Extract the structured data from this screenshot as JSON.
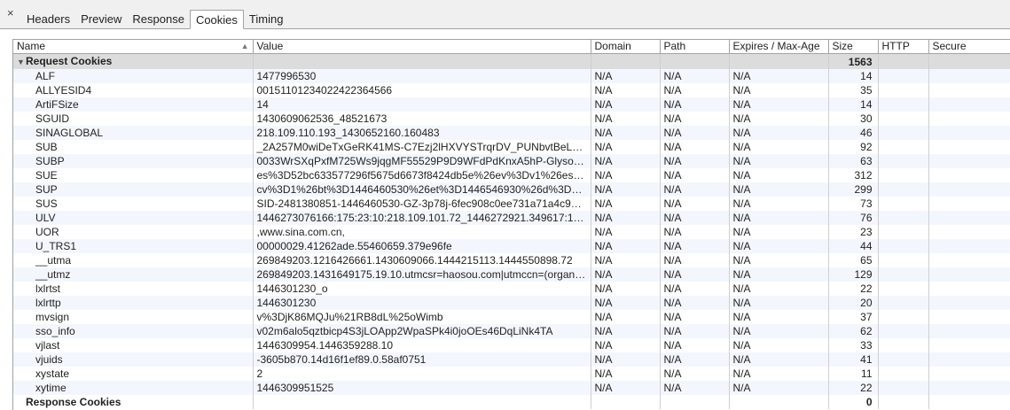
{
  "tabs": [
    {
      "label": "Headers",
      "active": false
    },
    {
      "label": "Preview",
      "active": false
    },
    {
      "label": "Response",
      "active": false
    },
    {
      "label": "Cookies",
      "active": true
    },
    {
      "label": "Timing",
      "active": false
    }
  ],
  "close_label": "×",
  "columns": {
    "name": "Name",
    "value": "Value",
    "domain": "Domain",
    "path": "Path",
    "expires": "Expires / Max-Age",
    "size": "Size",
    "http": "HTTP",
    "secure": "Secure"
  },
  "request_group": {
    "triangle": "▼",
    "label": "Request Cookies",
    "size": "1563"
  },
  "response_group": {
    "label": "Response Cookies",
    "size": "0"
  },
  "cookies": [
    {
      "name": "ALF",
      "value": "1477996530",
      "domain": "N/A",
      "path": "N/A",
      "expires": "N/A",
      "size": "14"
    },
    {
      "name": "ALLYESID4",
      "value": "0015110123402242236456​6",
      "domain": "N/A",
      "path": "N/A",
      "expires": "N/A",
      "size": "35"
    },
    {
      "name": "ArtiFSize",
      "value": "14",
      "domain": "N/A",
      "path": "N/A",
      "expires": "N/A",
      "size": "14"
    },
    {
      "name": "SGUID",
      "value": "1430609062536_48521673",
      "domain": "N/A",
      "path": "N/A",
      "expires": "N/A",
      "size": "30"
    },
    {
      "name": "SINAGLOBAL",
      "value": "218.109.110.193_1430652160.160483",
      "domain": "N/A",
      "path": "N/A",
      "expires": "N/A",
      "size": "46"
    },
    {
      "name": "SUB",
      "value": "_2A257M0wiDeTxGeRK41MS-C7Ezj2lHXVYSTrqrDV_PUNbvtBeLRfEk...",
      "domain": "N/A",
      "path": "N/A",
      "expires": "N/A",
      "size": "92"
    },
    {
      "name": "SUBP",
      "value": "0033WrSXqPxfM725Ws9jqgMF55529P9D9WFdPdKnxA5hP-Glysoea-BO",
      "domain": "N/A",
      "path": "N/A",
      "expires": "N/A",
      "size": "63"
    },
    {
      "name": "SUE",
      "value": "es%3D52bc633577296f5675d6673f8424db5e%26ev%3Dv1%26es2%3D...",
      "domain": "N/A",
      "path": "N/A",
      "expires": "N/A",
      "size": "312"
    },
    {
      "name": "SUP",
      "value": "cv%3D1%26bt%3D1446460530%26et%3D1446546930%26d%3D40c3%...",
      "domain": "N/A",
      "path": "N/A",
      "expires": "N/A",
      "size": "299"
    },
    {
      "name": "SUS",
      "value": "SID-2481380851-1446460530-GZ-3p78j-6fec908c0ee731a71a4c953ce2...",
      "domain": "N/A",
      "path": "N/A",
      "expires": "N/A",
      "size": "73"
    },
    {
      "name": "ULV",
      "value": "1446273076166:175:23:10:218.109.101.72_1446272921.349617:14462729...",
      "domain": "N/A",
      "path": "N/A",
      "expires": "N/A",
      "size": "76"
    },
    {
      "name": "UOR",
      "value": ",www.sina.com.cn,",
      "domain": "N/A",
      "path": "N/A",
      "expires": "N/A",
      "size": "23"
    },
    {
      "name": "U_TRS1",
      "value": "00000029.41262ade.55460659.379e96fe",
      "domain": "N/A",
      "path": "N/A",
      "expires": "N/A",
      "size": "44"
    },
    {
      "name": "__utma",
      "value": "269849203.1216426661.1430609066.1444215113.1444550898.72",
      "domain": "N/A",
      "path": "N/A",
      "expires": "N/A",
      "size": "65"
    },
    {
      "name": "__utmz",
      "value": "269849203.1431649175.19.10.utmcsr=haosou.com|utmccn=(organic)...",
      "domain": "N/A",
      "path": "N/A",
      "expires": "N/A",
      "size": "129"
    },
    {
      "name": "lxlrtst",
      "value": "1446301230_o",
      "domain": "N/A",
      "path": "N/A",
      "expires": "N/A",
      "size": "22"
    },
    {
      "name": "lxlrttp",
      "value": "1446301230",
      "domain": "N/A",
      "path": "N/A",
      "expires": "N/A",
      "size": "20"
    },
    {
      "name": "mvsign",
      "value": "v%3DjK86MQJu%21RB8dL%25oWimb",
      "domain": "N/A",
      "path": "N/A",
      "expires": "N/A",
      "size": "37"
    },
    {
      "name": "sso_info",
      "value": "v02m6alo5qztbicp4S3jLOApp2WpaSPk4i0joOEs46DqLiNk4TA",
      "domain": "N/A",
      "path": "N/A",
      "expires": "N/A",
      "size": "62"
    },
    {
      "name": "vjlast",
      "value": "1446309954.1446359288.10",
      "domain": "N/A",
      "path": "N/A",
      "expires": "N/A",
      "size": "33"
    },
    {
      "name": "vjuids",
      "value": "-3605b870.14d16f1ef89.0.58af0751",
      "domain": "N/A",
      "path": "N/A",
      "expires": "N/A",
      "size": "41"
    },
    {
      "name": "xystate",
      "value": "2",
      "domain": "N/A",
      "path": "N/A",
      "expires": "N/A",
      "size": "11"
    },
    {
      "name": "xytime",
      "value": "1446309951525",
      "domain": "N/A",
      "path": "N/A",
      "expires": "N/A",
      "size": "22"
    }
  ]
}
